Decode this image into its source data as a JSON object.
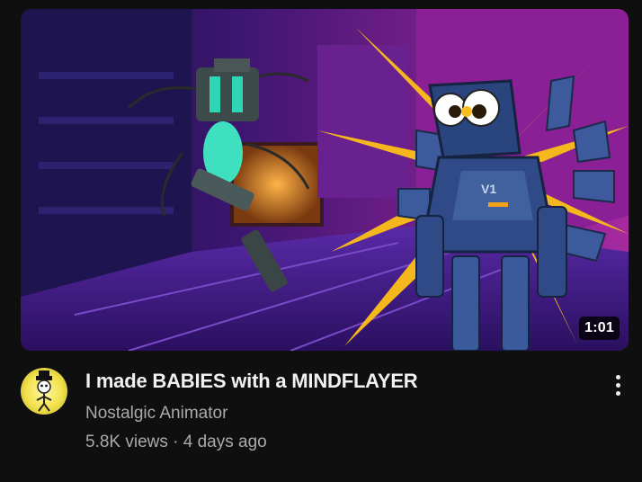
{
  "video": {
    "title": "I made BABIES with a MINDFLAYER",
    "channel": "Nostalgic Animator",
    "views": "5.8K views",
    "separator": " · ",
    "age": "4 days ago",
    "duration": "1:01",
    "thumbnail_badge_text": "V1"
  },
  "icons": {
    "menu": "more-vert-icon"
  },
  "colors": {
    "background": "#0f0f0f",
    "title": "#f1f1f1",
    "secondary_text": "#aaaaaa",
    "burst": "#f5b81c",
    "thumb_purple": "#5a1a78"
  }
}
